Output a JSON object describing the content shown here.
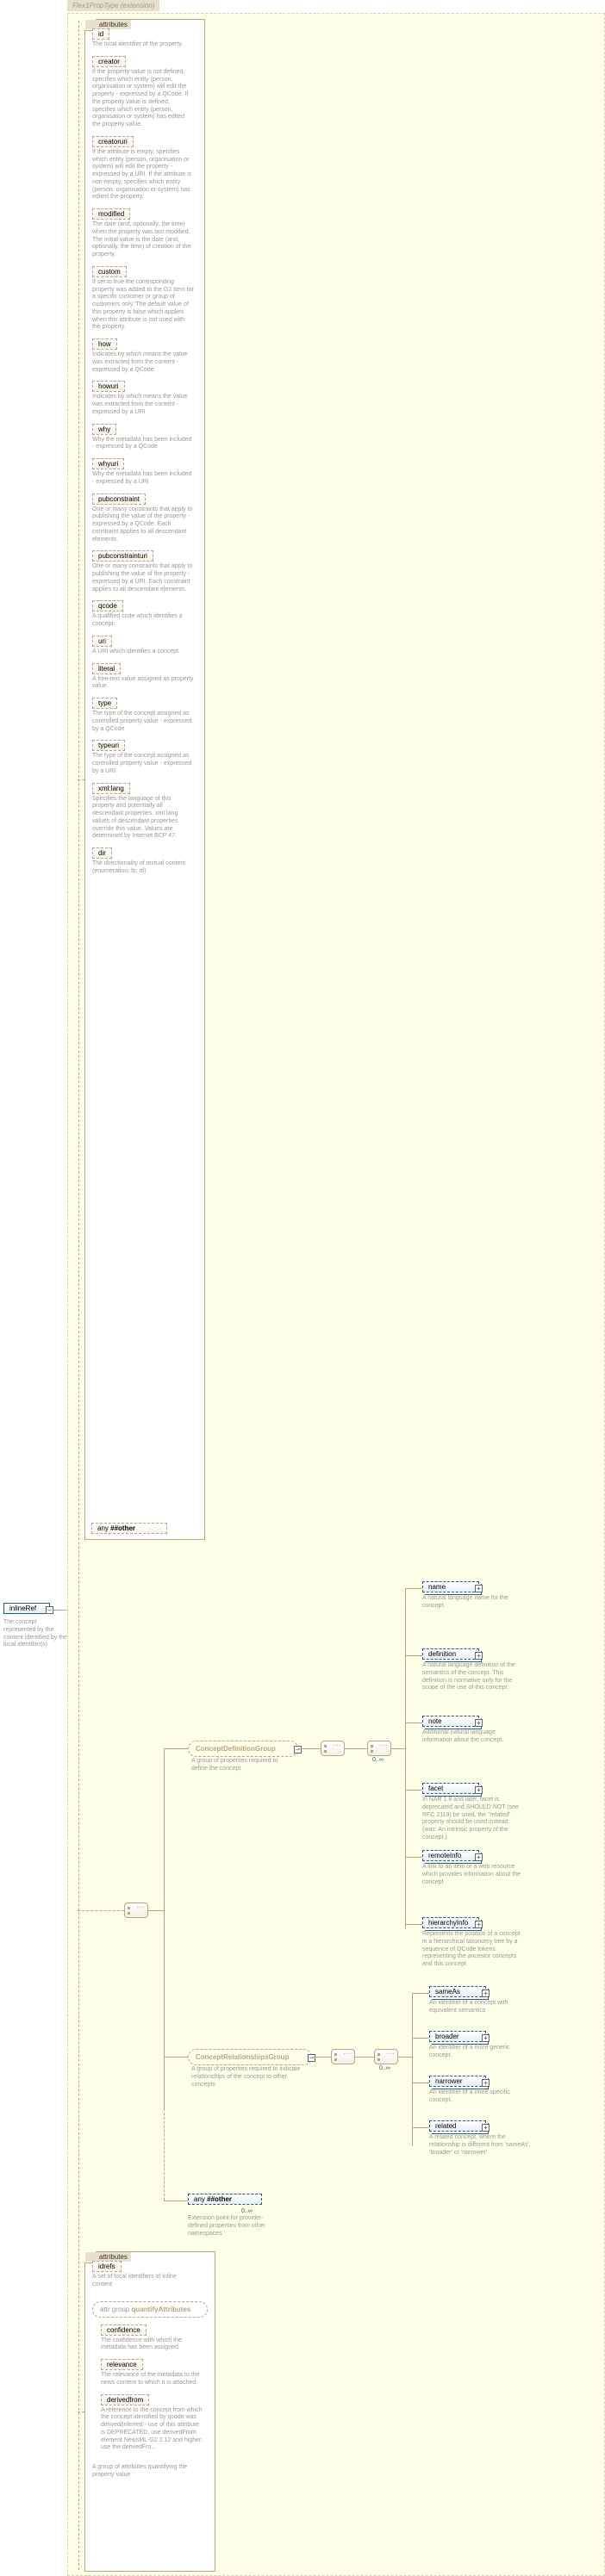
{
  "typeHeader": "Flex1PropType (extension)",
  "root": {
    "name": "inlineRef",
    "desc": "The concept represented by the content identified by the local identifier(s)"
  },
  "attrBoxLabel": "attributes",
  "attrs1": [
    {
      "name": "id",
      "desc": "The local identifier of the property."
    },
    {
      "name": "creator",
      "desc": "If the property value is not defined, specifies which entity (person, organisation or system) will edit the property - expressed by a QCode. If the property value is defined, specifies which entity (person, organisation or system) has edited the property value."
    },
    {
      "name": "creatoruri",
      "desc": "If the attribute is empty, specifies which entity (person, organisation or system) will edit the property - expressed by a URI. If the attribute is non-empty, specifies which entity (person, organisation or system) has edited the property."
    },
    {
      "name": "modified",
      "desc": "The date (and, optionally, the time) when the property was last modified. The initial value is the date (and, optionally, the time) of creation of the property."
    },
    {
      "name": "custom",
      "desc": "If set to true the corresponding property was added to the G2 Item for a specific customer or group of customers only. The default value of this property is false which applies when this attribute is not used with the property."
    },
    {
      "name": "how",
      "desc": "Indicates by which means the value was extracted from the content - expressed by a QCode"
    },
    {
      "name": "howuri",
      "desc": "Indicates by which means the value was extracted from the content - expressed by a URI"
    },
    {
      "name": "why",
      "desc": "Why the metadata has been included - expressed by a QCode"
    },
    {
      "name": "whyuri",
      "desc": "Why the metadata has been included - expressed by a URI"
    },
    {
      "name": "pubconstraint",
      "desc": "One or many constraints that apply to publishing the value of the property - expressed by a QCode. Each constraint applies to all descendant elements."
    },
    {
      "name": "pubconstrainturi",
      "desc": "One or many constraints that apply to publishing the value of the property - expressed by a URI. Each constraint applies to all descendant elements."
    },
    {
      "name": "qcode",
      "desc": "A qualified code which identifies a concept."
    },
    {
      "name": "uri",
      "desc": "A URI which identifies a concept."
    },
    {
      "name": "literal",
      "desc": "A free-text value assigned as property value."
    },
    {
      "name": "type",
      "desc": "The type of the concept assigned as controlled property value - expressed by a QCode"
    },
    {
      "name": "typeuri",
      "desc": "The type of the concept assigned as controlled property value - expressed by a URI"
    },
    {
      "name": "xml:lang",
      "desc": "Specifies the language of this property and potentially all descendant properties. xml:lang values of descendant properties override this value. Values are determined by Internet BCP 47."
    },
    {
      "name": "dir",
      "desc": "The directionality of textual content (enumeration: ltr, rtl)"
    }
  ],
  "anyOther": "##other",
  "anyLabel": "any",
  "cdg": {
    "title": "ConceptDefinitionGroup",
    "desc": "A group of properties required to define the concept"
  },
  "cdgChildren": [
    {
      "name": "name",
      "desc": "A natural language name for the concept."
    },
    {
      "name": "definition",
      "desc": "A natural language definition of the semantics of the concept. This definition is normative only for the scope of the use of this concept."
    },
    {
      "name": "note",
      "desc": "Additional natural language information about the concept."
    },
    {
      "name": "facet",
      "desc": "In NAR 1.8 and later, facet is deprecated and SHOULD NOT (see RFC 2119) be used, the \"related\" property should be used instead.(was: An intrinsic property of the concept.)"
    },
    {
      "name": "remoteInfo",
      "desc": "A link to an item or a web resource which provides information about the concept"
    },
    {
      "name": "hierarchyInfo",
      "desc": "Represents the position of a concept in a hierarchical taxonomy tree by a sequence of QCode tokens representing the ancestor concepts and this concept"
    }
  ],
  "crg": {
    "title": "ConceptRelationshipsGroup",
    "desc": "A group of properties required to indicate relationships of the concept to other concepts"
  },
  "crgChildren": [
    {
      "name": "sameAs",
      "desc": "An identifier of a concept with equivalent semantics"
    },
    {
      "name": "broader",
      "desc": "An identifier of a more generic concept."
    },
    {
      "name": "narrower",
      "desc": "An identifier of a more specific concept."
    },
    {
      "name": "related",
      "desc": "A related concept, where the relationship is different from 'sameAs', 'broader' or 'narrower'."
    }
  ],
  "extDesc": "Extension point for provider-defined properties from other namespaces",
  "attrs2": {
    "idrefs": {
      "name": "idrefs",
      "desc": "A set of local identifiers of inline content"
    }
  },
  "qagroup": {
    "title": "quantifyAttributes",
    "desc": "A group of attributes quantifying the property value",
    "prefix": "attr group"
  },
  "qaChildren": [
    {
      "name": "confidence",
      "desc": "The confidence with which the metadata has been assigned."
    },
    {
      "name": "relevance",
      "desc": "The relevance of the metadata to the news content to which it is attached."
    },
    {
      "name": "derivedfrom",
      "desc": "A reference to the concept from which the concept identified by qcode was derived/inferred - use of this attribute is DEPRECATED, use derivedFrom element NewsML-G2 2.12 and higher. use the derivedFro..."
    }
  ],
  "card": "0..∞"
}
